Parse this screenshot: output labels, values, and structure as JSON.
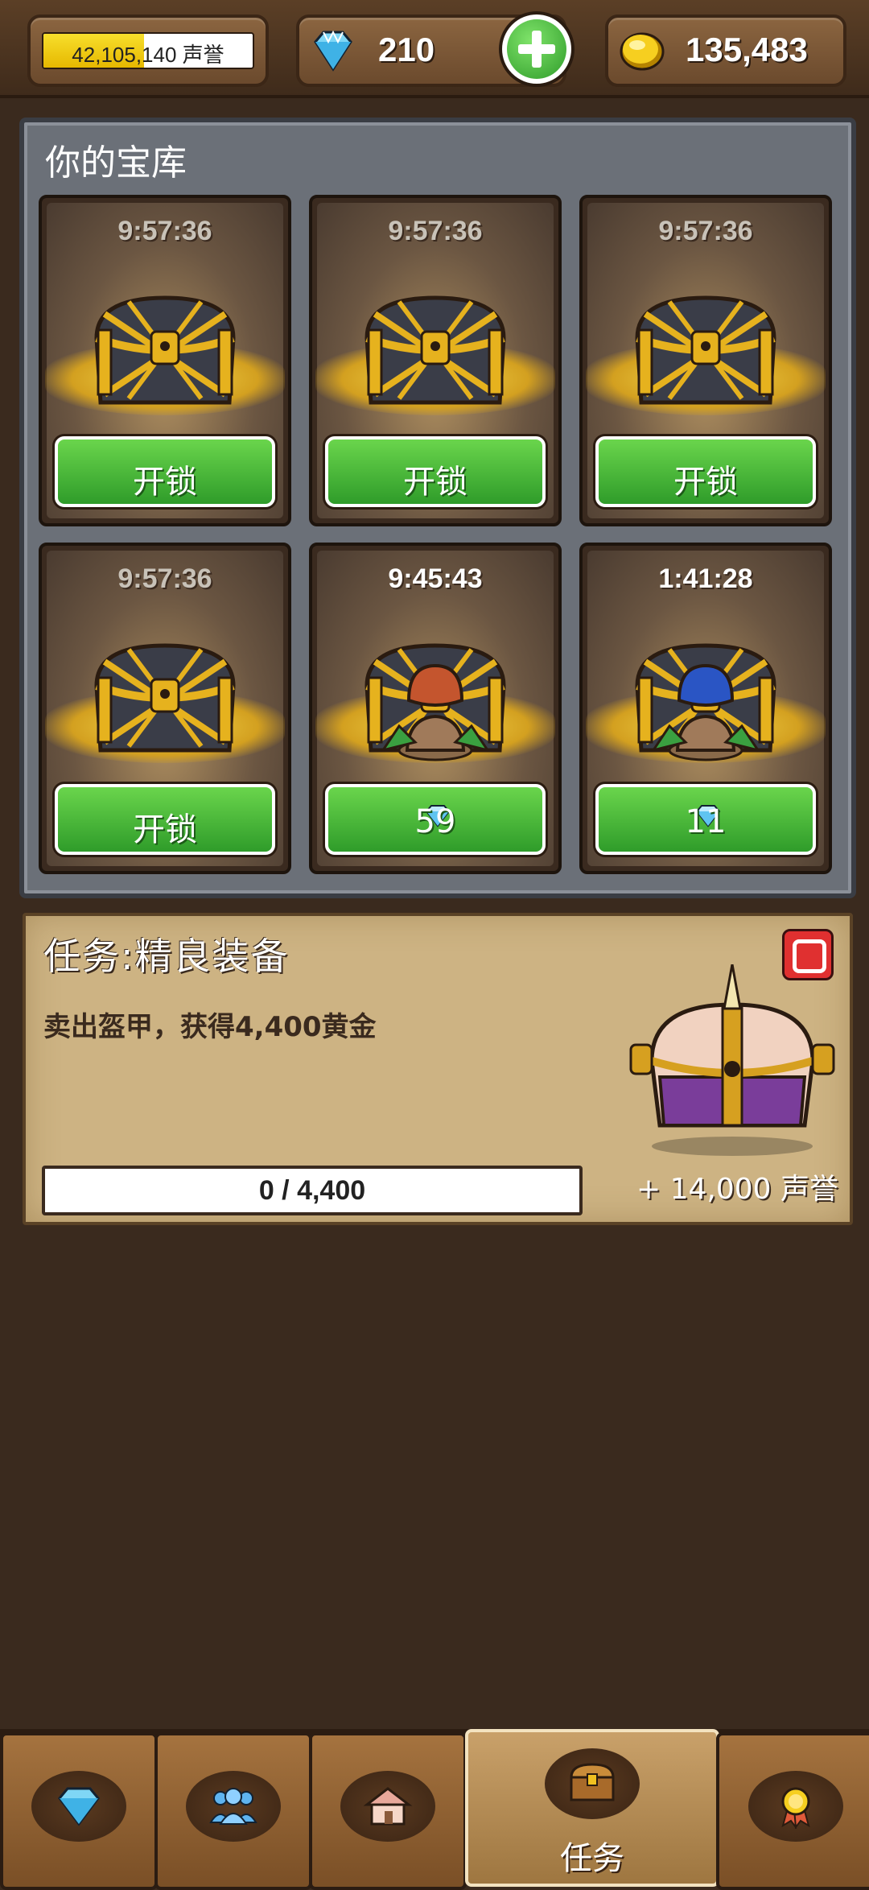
{
  "header": {
    "reputation": {
      "value": "42,105,140",
      "unit": "声誉",
      "progress": 0.48
    },
    "gems": {
      "value": "210",
      "icon": "diamond-icon"
    },
    "gold": {
      "value": "135,483",
      "icon": "gold-coin-icon"
    }
  },
  "vault": {
    "title": "你的宝库",
    "chests": [
      {
        "timer": "9:57:36",
        "button": "开锁",
        "state": "locked"
      },
      {
        "timer": "9:57:36",
        "button": "开锁",
        "state": "locked"
      },
      {
        "timer": "9:57:36",
        "button": "开锁",
        "state": "locked"
      },
      {
        "timer": "9:57:36",
        "button": "开锁",
        "state": "locked"
      },
      {
        "timer": "9:45:43",
        "button": "59",
        "state": "opening",
        "hat_color": "#c4552e"
      },
      {
        "timer": "1:41:28",
        "button": "11",
        "state": "opening",
        "hat_color": "#2a55c4"
      }
    ]
  },
  "quest": {
    "title": "任务:精良装备",
    "description": "卖出盔甲，获得4,400黄金",
    "progress_text": "0 / 4,400",
    "progress": 0,
    "reward": "+ 14,000 声誉"
  },
  "nav": {
    "tabs": [
      {
        "icon": "diamond-icon",
        "label": ""
      },
      {
        "icon": "people-icon",
        "label": ""
      },
      {
        "icon": "house-icon",
        "label": ""
      },
      {
        "icon": "treasure-chest-icon",
        "label": "任务",
        "active": true
      },
      {
        "icon": "medal-icon",
        "label": ""
      }
    ]
  },
  "colors": {
    "accent_green": "#4cc23a",
    "gold": "#f0c020",
    "panel": "#cdb383"
  }
}
